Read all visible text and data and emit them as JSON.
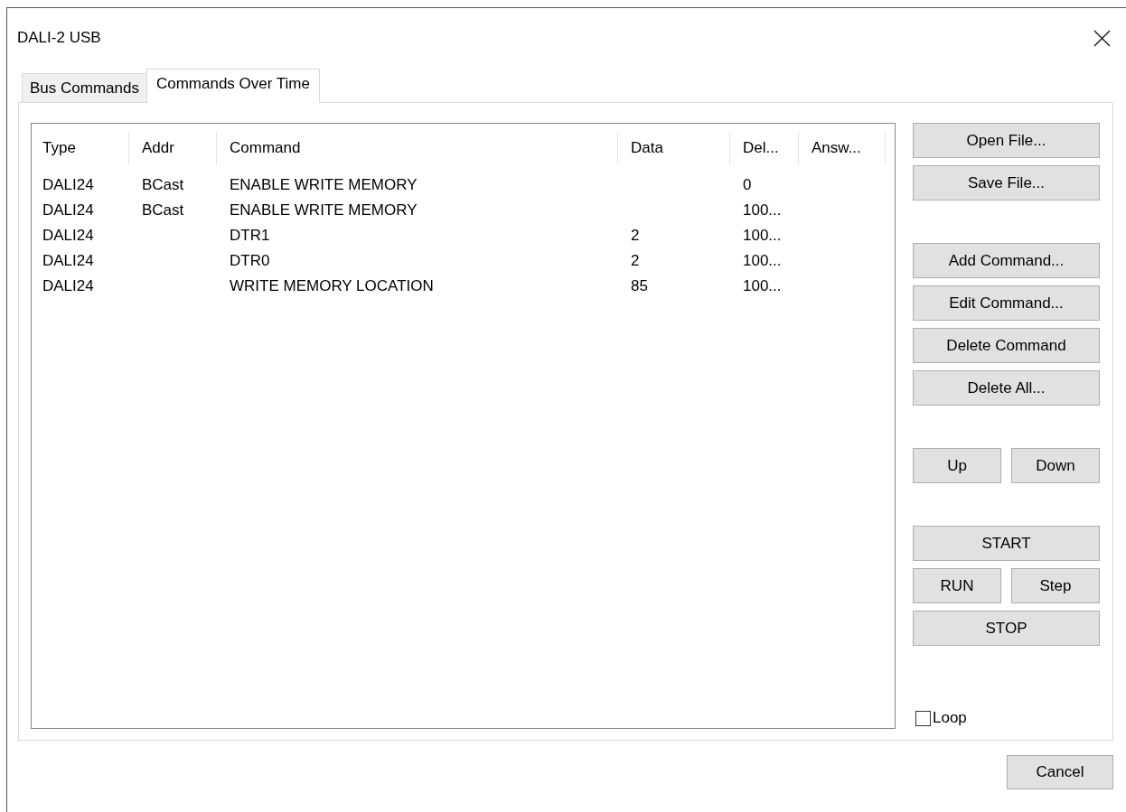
{
  "window": {
    "title": "DALI-2 USB"
  },
  "tabs": [
    {
      "label": "Bus Commands",
      "selected": false
    },
    {
      "label": "Commands Over Time",
      "selected": true
    }
  ],
  "table": {
    "columns": [
      "Type",
      "Addr",
      "Command",
      "Data",
      "Del...",
      "Answ..."
    ],
    "rows": [
      [
        "DALI24",
        "BCast",
        "ENABLE WRITE MEMORY",
        "",
        "0",
        ""
      ],
      [
        "DALI24",
        "BCast",
        "ENABLE WRITE MEMORY",
        "",
        "100...",
        ""
      ],
      [
        "DALI24",
        "",
        "DTR1",
        "2",
        "100...",
        ""
      ],
      [
        "DALI24",
        "",
        "DTR0",
        "2",
        "100...",
        ""
      ],
      [
        "DALI24",
        "",
        "WRITE MEMORY LOCATION",
        "85",
        "100...",
        ""
      ]
    ]
  },
  "button_groups": [
    [
      [
        "Open File..."
      ],
      [
        "Save File..."
      ]
    ],
    [
      [
        "Add Command..."
      ],
      [
        "Edit Command..."
      ],
      [
        "Delete Command"
      ],
      [
        "Delete All..."
      ]
    ],
    [
      [
        "Up",
        "Down"
      ]
    ],
    [
      [
        "START"
      ],
      [
        "RUN",
        "Step"
      ],
      [
        "STOP"
      ]
    ]
  ],
  "loop": {
    "label": "Loop",
    "checked": false
  },
  "footer_buttons": [
    "Cancel"
  ]
}
